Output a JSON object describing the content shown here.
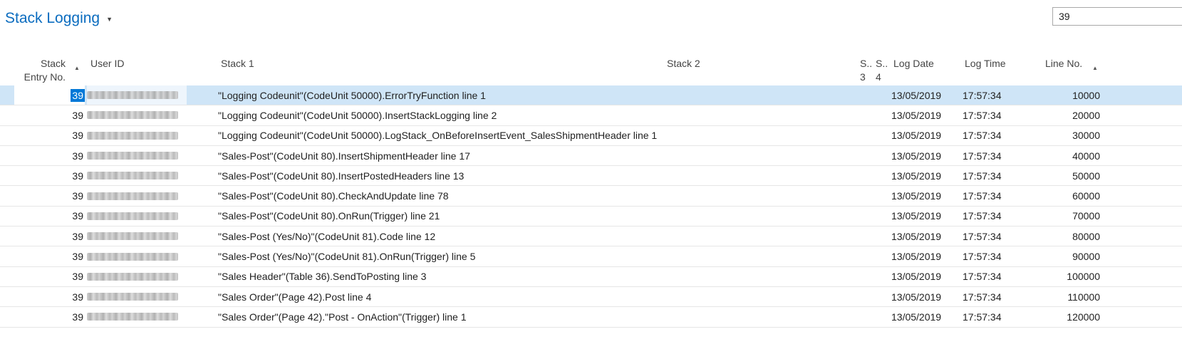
{
  "page": {
    "title": "Stack Logging",
    "filter_value": "39"
  },
  "columns": {
    "entry_no_line1": "Stack",
    "entry_no_line2": "Entry No.",
    "user_id": "User ID",
    "stack1": "Stack 1",
    "stack2": "Stack 2",
    "stack3_line1": "S..",
    "stack3_line2": "3",
    "stack4_line1": "S..",
    "stack4_line2": "4",
    "log_date": "Log Date",
    "log_time": "Log Time",
    "line_no": "Line No."
  },
  "rows": [
    {
      "entry": "39",
      "stack1": "\"Logging Codeunit\"(CodeUnit 50000).ErrorTryFunction line 1",
      "date": "13/05/2019",
      "time": "17:57:34",
      "line": "10000",
      "selected": true
    },
    {
      "entry": "39",
      "stack1": "\"Logging Codeunit\"(CodeUnit 50000).InsertStackLogging line 2",
      "date": "13/05/2019",
      "time": "17:57:34",
      "line": "20000"
    },
    {
      "entry": "39",
      "stack1": "\"Logging Codeunit\"(CodeUnit 50000).LogStack_OnBeforeInsertEvent_SalesShipmentHeader line 1",
      "date": "13/05/2019",
      "time": "17:57:34",
      "line": "30000"
    },
    {
      "entry": "39",
      "stack1": "\"Sales-Post\"(CodeUnit 80).InsertShipmentHeader line 17",
      "date": "13/05/2019",
      "time": "17:57:34",
      "line": "40000"
    },
    {
      "entry": "39",
      "stack1": "\"Sales-Post\"(CodeUnit 80).InsertPostedHeaders line 13",
      "date": "13/05/2019",
      "time": "17:57:34",
      "line": "50000"
    },
    {
      "entry": "39",
      "stack1": "\"Sales-Post\"(CodeUnit 80).CheckAndUpdate line 78",
      "date": "13/05/2019",
      "time": "17:57:34",
      "line": "60000"
    },
    {
      "entry": "39",
      "stack1": "\"Sales-Post\"(CodeUnit 80).OnRun(Trigger) line 21",
      "date": "13/05/2019",
      "time": "17:57:34",
      "line": "70000"
    },
    {
      "entry": "39",
      "stack1": "\"Sales-Post (Yes/No)\"(CodeUnit 81).Code line 12",
      "date": "13/05/2019",
      "time": "17:57:34",
      "line": "80000"
    },
    {
      "entry": "39",
      "stack1": "\"Sales-Post (Yes/No)\"(CodeUnit 81).OnRun(Trigger) line 5",
      "date": "13/05/2019",
      "time": "17:57:34",
      "line": "90000"
    },
    {
      "entry": "39",
      "stack1": "\"Sales Header\"(Table 36).SendToPosting line 3",
      "date": "13/05/2019",
      "time": "17:57:34",
      "line": "100000"
    },
    {
      "entry": "39",
      "stack1": "\"Sales Order\"(Page 42).Post line 4",
      "date": "13/05/2019",
      "time": "17:57:34",
      "line": "110000"
    },
    {
      "entry": "39",
      "stack1": "\"Sales Order\"(Page 42).\"Post - OnAction\"(Trigger) line 1",
      "date": "13/05/2019",
      "time": "17:57:34",
      "line": "120000"
    }
  ],
  "icons": {
    "title_caret": "caret-down-icon",
    "sort": "sort-ascending-icon"
  }
}
